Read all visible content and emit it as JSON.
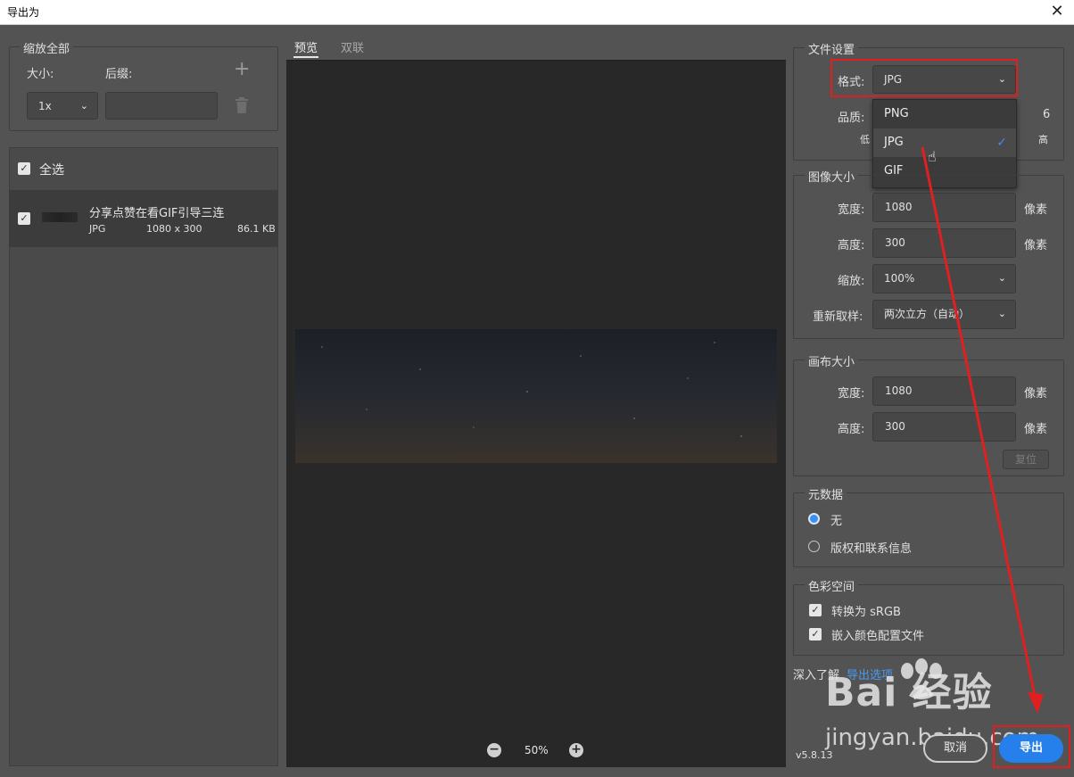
{
  "window": {
    "title": "导出为",
    "close_glyph": "✕"
  },
  "left": {
    "scale_group": {
      "legend": "缩放全部",
      "size_label": "大小:",
      "suffix_label": "后缀:",
      "size_value": "1x",
      "suffix_value": ""
    },
    "assets": {
      "select_all_label": "全选",
      "items": [
        {
          "name": "分享点赞在看GIF引导三连",
          "format": "JPG",
          "dimensions": "1080 x 300",
          "filesize": "86.1 KB",
          "checked": true
        }
      ]
    }
  },
  "preview": {
    "tabs": [
      {
        "label": "预览",
        "active": true
      },
      {
        "label": "双联",
        "active": false
      }
    ],
    "zoom_level": "50%"
  },
  "file_settings": {
    "legend": "文件设置",
    "format_label": "格式:",
    "format_value": "JPG",
    "format_options": [
      "PNG",
      "JPG",
      "GIF"
    ],
    "quality_label": "品质:",
    "quality_value": "6",
    "quality_low": "低",
    "quality_high": "高"
  },
  "image_size": {
    "legend": "图像大小",
    "width_label": "宽度:",
    "width_value": "1080",
    "height_label": "高度:",
    "height_value": "300",
    "unit": "像素",
    "scale_label": "缩放:",
    "scale_value": "100%",
    "resample_label": "重新取样:",
    "resample_value": "两次立方（自动）"
  },
  "canvas_size": {
    "legend": "画布大小",
    "width_label": "宽度:",
    "width_value": "1080",
    "height_label": "高度:",
    "height_value": "300",
    "unit": "像素",
    "reset_label": "复位"
  },
  "metadata": {
    "legend": "元数据",
    "options": [
      {
        "label": "无",
        "selected": true
      },
      {
        "label": "版权和联系信息",
        "selected": false
      }
    ]
  },
  "color_space": {
    "legend": "色彩空间",
    "convert_srgb_label": "转换为 sRGB",
    "embed_profile_label": "嵌入颜色配置文件"
  },
  "footer": {
    "learn_label": "深入了解",
    "learn_link": "导出选项",
    "version": "v5.8.13",
    "cancel_label": "取消",
    "export_label": "导出"
  },
  "watermark": {
    "brand": "Bai  经验",
    "url": "jingyan.baidu.com"
  },
  "colors": {
    "accent": "#2680eb",
    "annotation_red": "#e02020",
    "link": "#4a9af0"
  }
}
